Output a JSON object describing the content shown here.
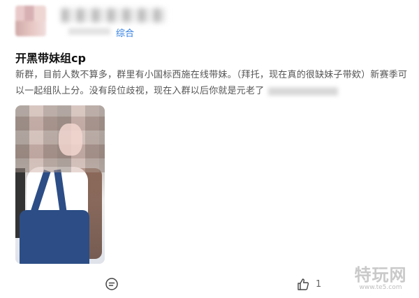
{
  "post": {
    "category": "综合",
    "title": "开黑带妹组cp",
    "body": "新群，目前人数不算多，群里有小国标西施在线带妹。（拜托，现在真的很缺妹子带欸）新赛季可以一起组队上分。没有段位歧视，现在入群以后你就是元老了"
  },
  "actions": {
    "like_count": "1"
  },
  "icons": {
    "comment": "comment-icon",
    "like": "thumbs-up-icon"
  },
  "watermark": {
    "text": "特玩网",
    "url": "www.te5.com"
  },
  "colors": {
    "accent": "#2f7de1"
  }
}
